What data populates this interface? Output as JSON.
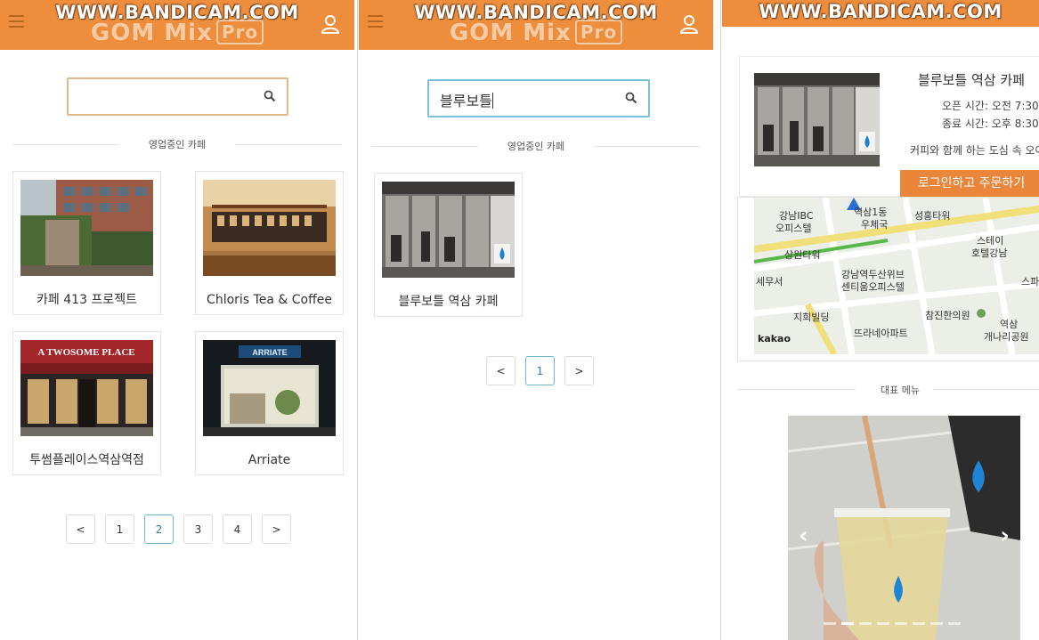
{
  "watermark": {
    "url": "WWW.BANDICAM.COM",
    "brand": "GOM Mix",
    "brand_tag": "Pro"
  },
  "panel1": {
    "search_value": "",
    "section_title": "영업중인 카페",
    "cards": [
      {
        "label": "카페 413 프로젝트",
        "icon": "cafe-photo"
      },
      {
        "label": "Chloris Tea & Coffee",
        "icon": "cafe-photo"
      },
      {
        "label": "투썸플레이스역삼역점",
        "icon": "cafe-photo",
        "sign": "A TWOSOME PLACE"
      },
      {
        "label": "Arriate",
        "icon": "cafe-photo",
        "sign": "ARRIATE"
      }
    ],
    "pagination": {
      "prev": "<",
      "pages": [
        "1",
        "2",
        "3",
        "4"
      ],
      "current": "2",
      "next": ">"
    }
  },
  "panel2": {
    "search_value": "블루보틀",
    "section_title": "영업중인 카페",
    "cards": [
      {
        "label": "블루보틀 역삼 카페",
        "icon": "cafe-photo"
      }
    ],
    "pagination": {
      "prev": "<",
      "pages": [
        "1"
      ],
      "current": "1",
      "next": ">"
    }
  },
  "panel3": {
    "title": "블루보틀 역삼 카페",
    "open_time": "오픈 시간: 오전 7:30",
    "close_time": "종료 시간: 오후 8:30",
    "description": "커피와 함께 하는 도심 속 오아시",
    "order_button": "로그인하고 주문하기",
    "map": {
      "provider": "kakao",
      "labels": [
        "강남IBC",
        "오피스텔",
        "역삼1동",
        "우체국",
        "성홍타워",
        "스테이",
        "호텔강남",
        "상원타워",
        "강남역두산위브",
        "센티움오피스텔",
        "세무서",
        "스파르",
        "지희빌딩",
        "참진한의원",
        "역삼",
        "개나리공원",
        "뜨라네아파트"
      ]
    },
    "section_title": "대표 메뉴",
    "carousel": {
      "prev": "‹",
      "next": "›",
      "slide_count": 8,
      "active_index": 1
    }
  },
  "colors": {
    "topbar": "#ee8d3b",
    "accent": "#e9863a",
    "search_active": "#7cc0dc",
    "search_idle": "#e0b98a"
  }
}
